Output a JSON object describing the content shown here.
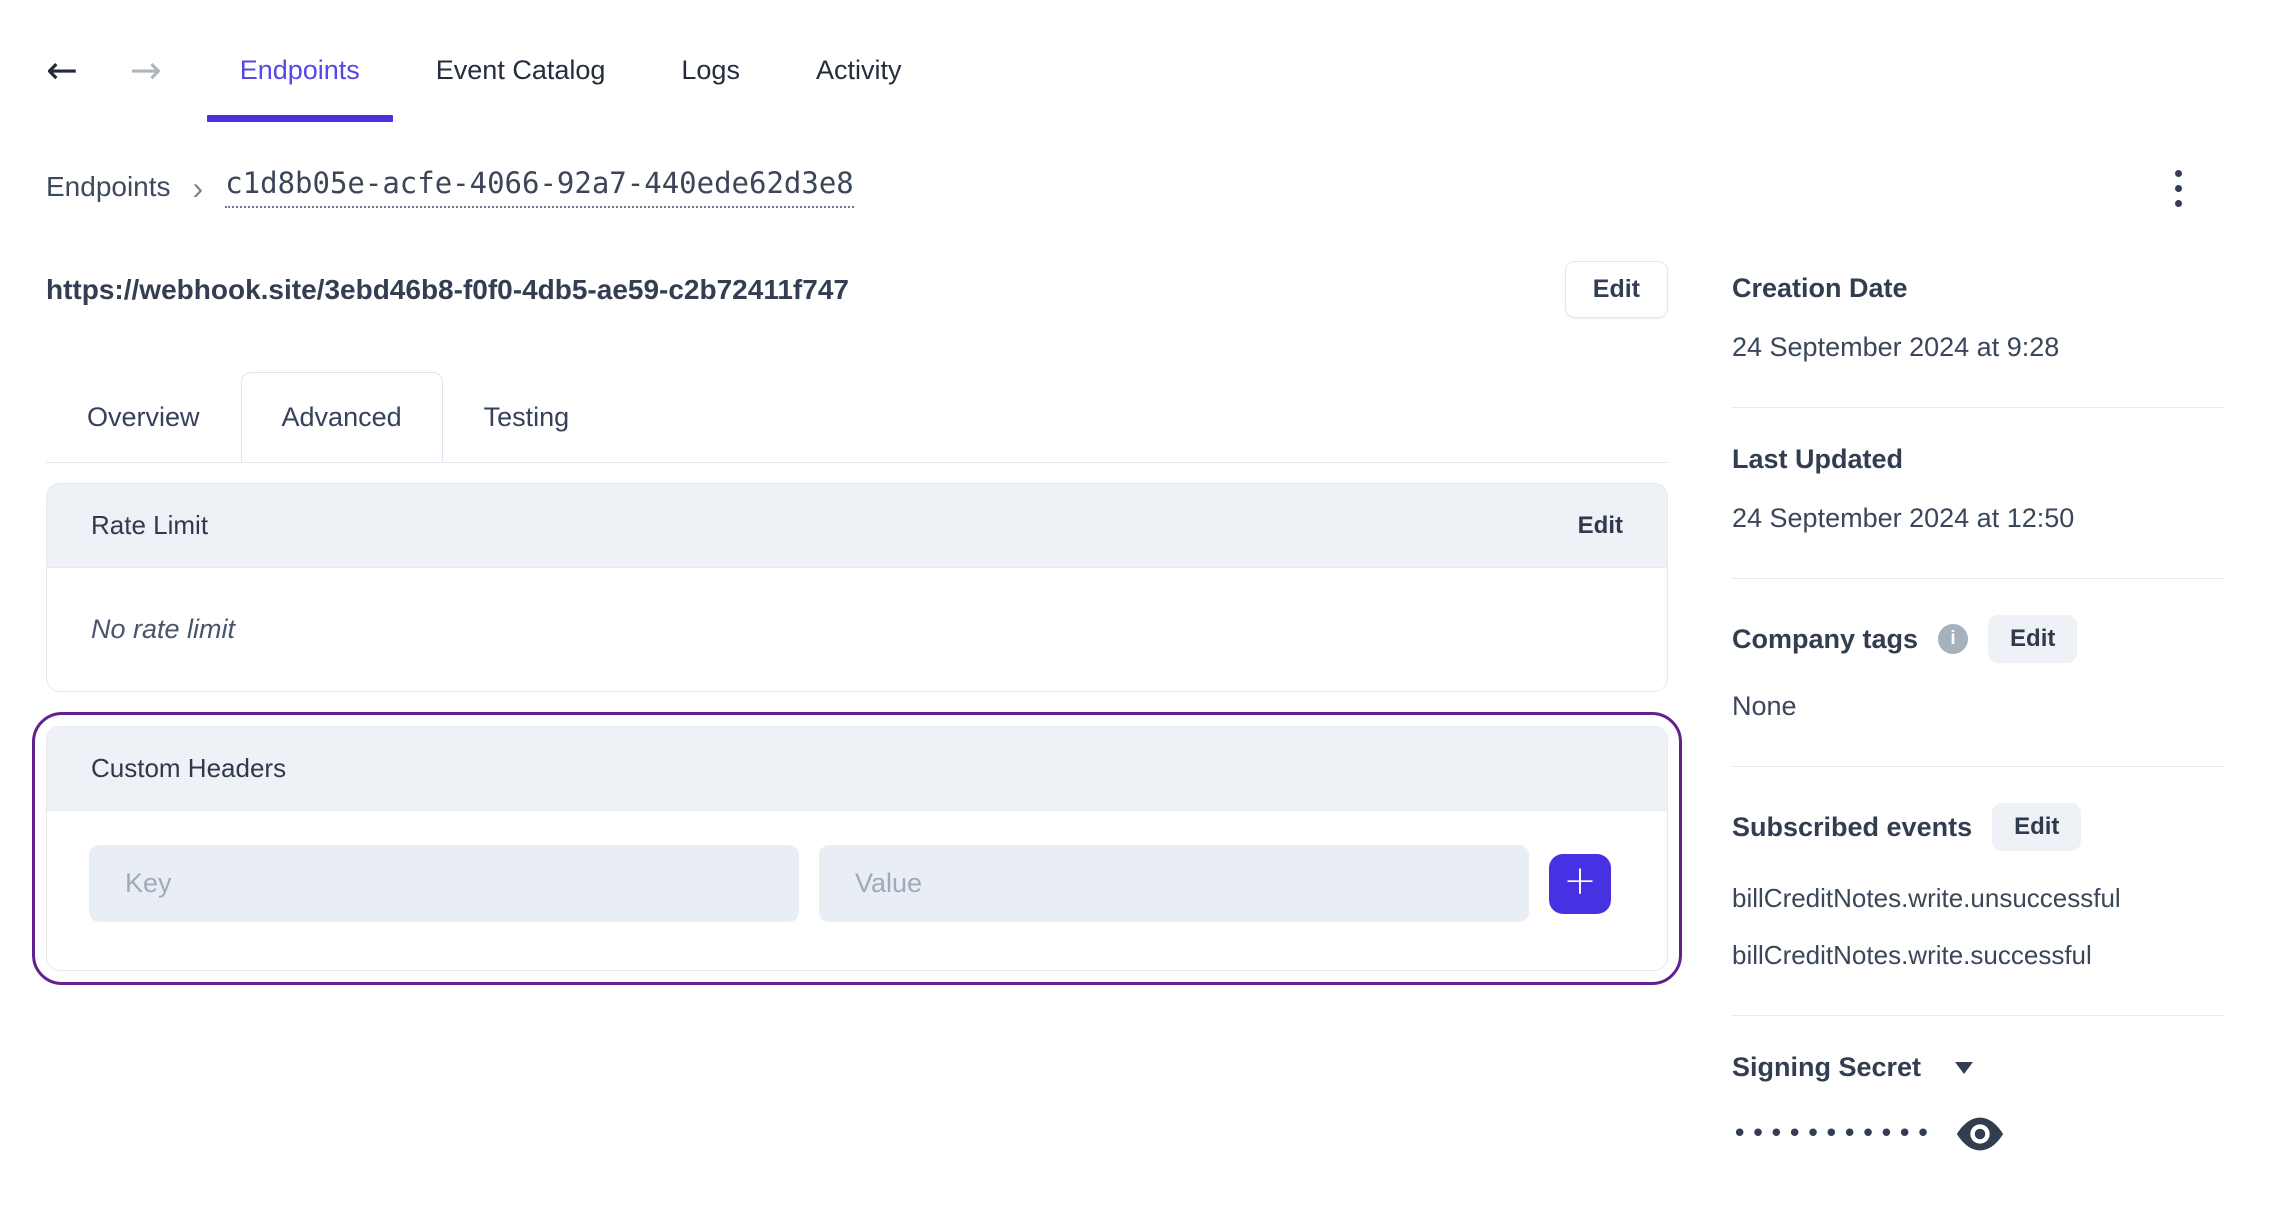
{
  "nav": {
    "back_icon": "←",
    "forward_icon": "→",
    "tabs": [
      {
        "label": "Endpoints",
        "active": true
      },
      {
        "label": "Event Catalog",
        "active": false
      },
      {
        "label": "Logs",
        "active": false
      },
      {
        "label": "Activity",
        "active": false
      }
    ]
  },
  "breadcrumb": {
    "root": "Endpoints",
    "separator": "›",
    "endpoint_id": "c1d8b05e-acfe-4066-92a7-440ede62d3e8"
  },
  "endpoint": {
    "url": "https://webhook.site/3ebd46b8-f0f0-4db5-ae59-c2b72411f747",
    "edit_label": "Edit"
  },
  "detail_tabs": [
    {
      "label": "Overview",
      "active": false
    },
    {
      "label": "Advanced",
      "active": true
    },
    {
      "label": "Testing",
      "active": false
    }
  ],
  "rate_limit": {
    "title": "Rate Limit",
    "edit_label": "Edit",
    "empty_text": "No rate limit"
  },
  "custom_headers": {
    "title": "Custom Headers",
    "key_placeholder": "Key",
    "value_placeholder": "Value",
    "add_button": "+"
  },
  "sidebar": {
    "creation_date": {
      "label": "Creation Date",
      "value": "24 September 2024 at 9:28"
    },
    "last_updated": {
      "label": "Last Updated",
      "value": "24 September 2024 at 12:50"
    },
    "company_tags": {
      "label": "Company tags",
      "info_icon": "i",
      "edit_label": "Edit",
      "value": "None"
    },
    "subscribed_events": {
      "label": "Subscribed events",
      "edit_label": "Edit",
      "events": [
        "billCreditNotes.write.unsuccessful",
        "billCreditNotes.write.successful"
      ]
    },
    "signing_secret": {
      "label": "Signing Secret",
      "masked_value": "•••••••••••"
    }
  },
  "colors": {
    "accent_text": "#5746e8",
    "accent_underline": "#4b30e0",
    "add_button": "#4631e3",
    "highlight_ring": "#63218f",
    "panel_header_bg": "#eef1f6",
    "text_dark": "#2f3a4c"
  }
}
